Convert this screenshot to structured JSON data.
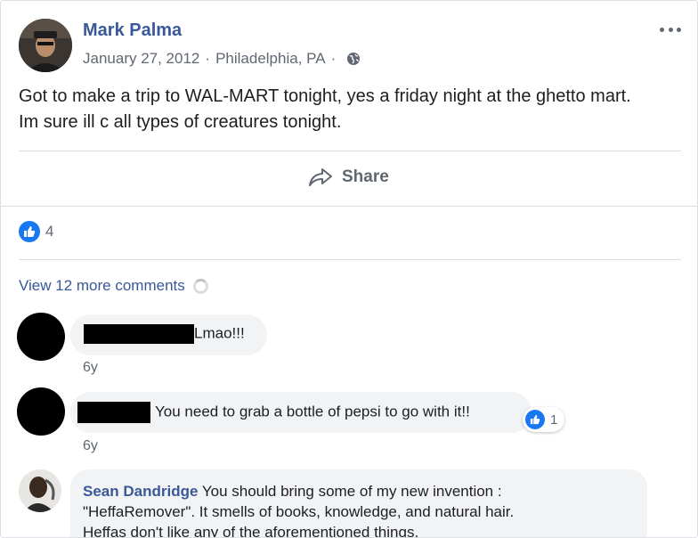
{
  "post": {
    "author": "Mark Palma",
    "date": "January 27, 2012",
    "separator": "·",
    "location": "Philadelphia, PA",
    "privacy_icon": "globe-icon",
    "text_line1": "Got to make a trip to WAL-MART tonight, yes a friday night at the ghetto mart.",
    "text_line2": "Im sure ill c all types of creatures tonight."
  },
  "actions": {
    "share_label": "Share",
    "share_icon": "share-arrow-icon"
  },
  "reactions": {
    "icon": "like-icon",
    "count": "4"
  },
  "comments": {
    "view_more": "View 12 more comments",
    "items": [
      {
        "text": "Lmao!!!",
        "time": "6y"
      },
      {
        "text": "You need to grab a bottle of pepsi to go with it!!",
        "time": "6y",
        "reaction_count": "1"
      },
      {
        "author": "Sean Dandridge",
        "text_line1": "You should bring some of my new invention :",
        "text_line2": "\"HeffaRemover\". It smells of books, knowledge, and natural hair.",
        "text_line3": "Heffas don't like any of the aforementioned things."
      }
    ]
  },
  "colors": {
    "link": "#385898",
    "secondary_text": "#606770",
    "like_blue": "#1877f2",
    "bubble_bg": "#f2f3f5"
  }
}
